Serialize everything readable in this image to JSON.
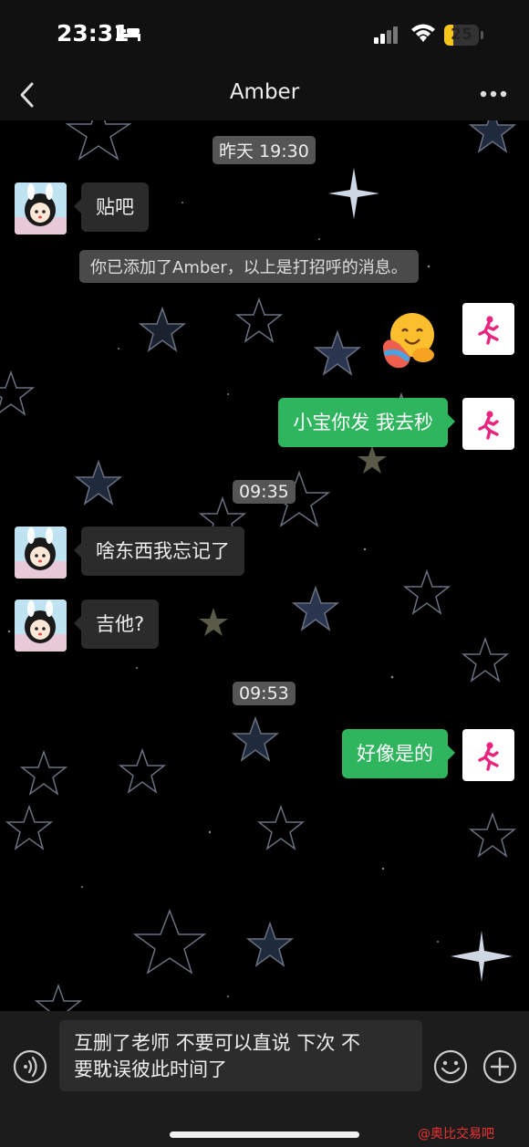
{
  "status_bar": {
    "time": "23:31",
    "battery_level": "25",
    "icons": [
      "bed-icon",
      "signal-icon",
      "wifi-icon",
      "battery-icon"
    ]
  },
  "header": {
    "title": "Amber",
    "back_icon": "chevron-left-icon",
    "more_icon": "more-horizontal-icon"
  },
  "chat": {
    "timestamps": [
      "昨天 19:30",
      "09:35",
      "09:53"
    ],
    "system_notice": "你已添加了Amber，以上是打招呼的消息。",
    "messages": [
      {
        "direction": "in",
        "text": "贴吧"
      },
      {
        "direction": "out",
        "type": "sticker",
        "sticker": "hug-emoji-sticker"
      },
      {
        "direction": "out",
        "text": "小宝你发 我去秒"
      },
      {
        "direction": "in",
        "text": "啥东西我忘记了"
      },
      {
        "direction": "in",
        "text": "吉他?"
      },
      {
        "direction": "out",
        "text": "好像是的"
      }
    ]
  },
  "input_bar": {
    "draft": "互删了老师 不要可以直说 下次 不要耽误彼此时间了",
    "draft_line1": "互删了老师 不要可以直说 下次 不",
    "draft_line2": "要耽误彼此时间了",
    "icons": [
      "voice-icon",
      "emoji-icon",
      "plus-icon"
    ]
  },
  "watermark": "@奥比交易吧",
  "colors": {
    "outgoing_bubble": "#2fb55d",
    "incoming_bubble": "#2b2b2b",
    "background": "#000000",
    "battery_fill": "#f5c518"
  }
}
